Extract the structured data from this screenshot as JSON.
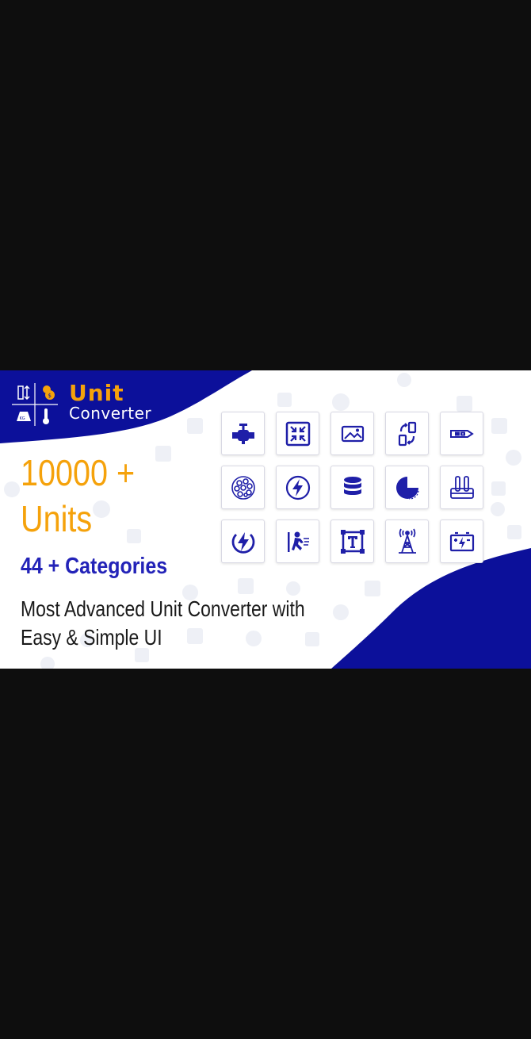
{
  "app": {
    "logo_word1": "Unit",
    "logo_word2": "Converter",
    "logo_icon_labels": {
      "kg": "KG"
    }
  },
  "headline": {
    "line1": "10000 +",
    "line2": "Units"
  },
  "categories_text": "44 +  Categories",
  "tagline": {
    "line1": "Most Advanced Unit Converter with",
    "line2": "Easy & Simple UI"
  },
  "icons": [
    "pipe-valve-icon",
    "compress-icon",
    "image-icon",
    "data-transfer-icon",
    "usb-stick-icon",
    "cells-icon",
    "lightning-circle-icon",
    "database-icon",
    "pie-chart-icon",
    "test-tubes-icon",
    "power-icon",
    "running-person-icon",
    "text-box-icon",
    "radio-tower-icon",
    "battery-icon"
  ],
  "colors": {
    "accent_orange": "#f5a20b",
    "brand_blue": "#0c109a",
    "text_blue": "#2323b8",
    "background": "#0e0e0e"
  }
}
